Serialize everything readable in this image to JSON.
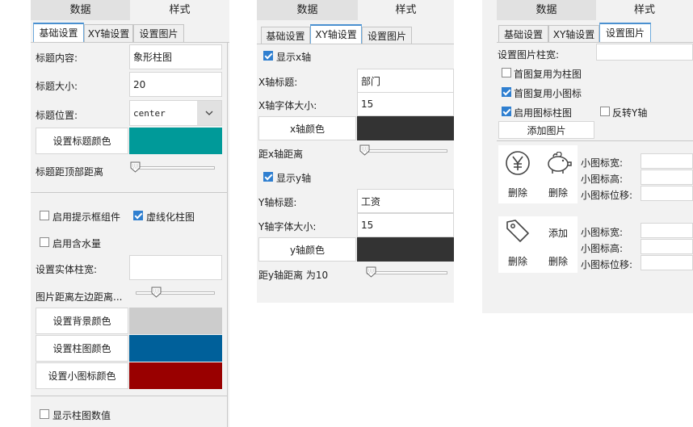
{
  "panel1": {
    "top_tabs": [
      "数据",
      "样式"
    ],
    "sub_tabs": [
      "基础设置",
      "XY轴设置",
      "设置图片"
    ],
    "title_content_label": "标题内容:",
    "title_content_value": "象形柱图",
    "title_size_label": "标题大小:",
    "title_size_value": "20",
    "title_pos_label": "标题位置:",
    "title_pos_value": "center",
    "title_color_btn": "设置标题颜色",
    "title_top_dist_label": "标题距顶部距离",
    "tooltip_label": "启用提示框组件",
    "dashed_bar_label": "虚线化柱图",
    "water_label": "启用含水量",
    "solid_width_label": "设置实体柱宽:",
    "img_left_dist_label": "图片距离左边距离...",
    "bg_color_btn": "设置背景颜色",
    "bar_color_btn": "设置柱图颜色",
    "small_icon_color_btn": "设置小图标颜色",
    "show_value_label": "显示柱图数值",
    "colors": {
      "title": "#009a99",
      "bg": "#cccccc",
      "bar": "#00609a",
      "small_icon": "#990000"
    }
  },
  "panel2": {
    "top_tabs": [
      "数据",
      "样式"
    ],
    "sub_tabs": [
      "基础设置",
      "XY轴设置",
      "设置图片"
    ],
    "show_x_label": "显示x轴",
    "x_title_label": "X轴标题:",
    "x_title_value": "部门",
    "x_font_label": "X轴字体大小:",
    "x_font_value": "15",
    "x_color_btn": "x轴颜色",
    "x_dist_label": "距x轴距离",
    "show_y_label": "显示y轴",
    "y_title_label": "Y轴标题:",
    "y_title_value": "工资",
    "y_font_label": "Y轴字体大小:",
    "y_font_value": "15",
    "y_color_btn": "y轴颜色",
    "y_dist_label": "距y轴距离 为10",
    "colors": {
      "x_axis": "#333333",
      "y_axis": "#333333"
    }
  },
  "panel3": {
    "top_tabs": [
      "数据",
      "样式"
    ],
    "sub_tabs": [
      "基础设置",
      "XY轴设置",
      "设置图片"
    ],
    "img_width_label": "设置图片柱宽:",
    "reuse_bar_label": "首图复用为柱图",
    "reuse_small_label": "首图复用小图标",
    "enable_icon_bar_label": "启用图标柱图",
    "flip_y_label": "反转Y轴",
    "add_img_btn": "添加图片",
    "delete_label": "删除",
    "add_label": "添加",
    "small_width_label": "小图标宽:",
    "small_height_label": "小图标高:",
    "small_offset_label": "小图标位移:",
    "icons": [
      "yen-circle-icon",
      "piggy-bank-icon",
      "price-tag-icon"
    ]
  }
}
